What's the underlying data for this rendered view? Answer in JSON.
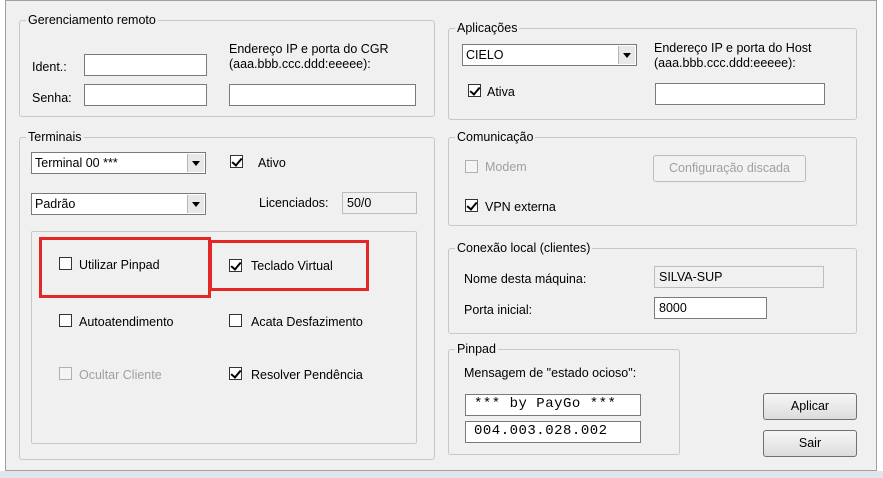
{
  "remote": {
    "legend": "Gerenciamento remoto",
    "ident_label": "Ident.:",
    "ident_value": "",
    "senha_label": "Senha:",
    "senha_value": "",
    "cgr_label_1": "Endereço IP e porta do CGR",
    "cgr_label_2": "(aaa.bbb.ccc.ddd:eeeee):",
    "cgr_value": ""
  },
  "apps": {
    "legend": "Aplicações",
    "selected": "CIELO",
    "host_label_1": "Endereço IP e porta do Host",
    "host_label_2": "(aaa.bbb.ccc.ddd:eeeee):",
    "host_value": "",
    "ativa_label": "Ativa",
    "ativa_checked": true
  },
  "terminals": {
    "legend": "Terminais",
    "terminal_selected": "Terminal 00 ***",
    "mode_selected": "Padrão",
    "ativo_label": "Ativo",
    "ativo_checked": true,
    "licenciados_label": "Licenciados:",
    "licenciados_value": "50/0",
    "options": {
      "pinpad": {
        "label": "Utilizar Pinpad",
        "checked": false,
        "enabled": true
      },
      "teclado": {
        "label": "Teclado Virtual",
        "checked": true,
        "enabled": true
      },
      "autoatendimento": {
        "label": "Autoatendimento",
        "checked": false,
        "enabled": true
      },
      "desfazimento": {
        "label": "Acata Desfazimento",
        "checked": false,
        "enabled": true
      },
      "ocultar": {
        "label": "Ocultar Cliente",
        "checked": false,
        "enabled": false
      },
      "pendencia": {
        "label": "Resolver Pendência",
        "checked": true,
        "enabled": true
      }
    }
  },
  "comm": {
    "legend": "Comunicação",
    "modem_label": "Modem",
    "modem_checked": false,
    "dial_button": "Configuração discada",
    "vpn_label": "VPN externa",
    "vpn_checked": true
  },
  "local": {
    "legend": "Conexão local (clientes)",
    "machine_label": "Nome desta máquina:",
    "machine_value": "SILVA-SUP",
    "port_label": "Porta inicial:",
    "port_value": "8000"
  },
  "pinpad": {
    "legend": "Pinpad",
    "idle_label": "Mensagem de \"estado ocioso\":",
    "line1": "*** by PayGo ***",
    "line2": "004.003.028.002"
  },
  "buttons": {
    "apply": "Aplicar",
    "exit": "Sair"
  },
  "colors": {
    "highlight": "#e32626",
    "window_bg": "#f0f0f0"
  }
}
